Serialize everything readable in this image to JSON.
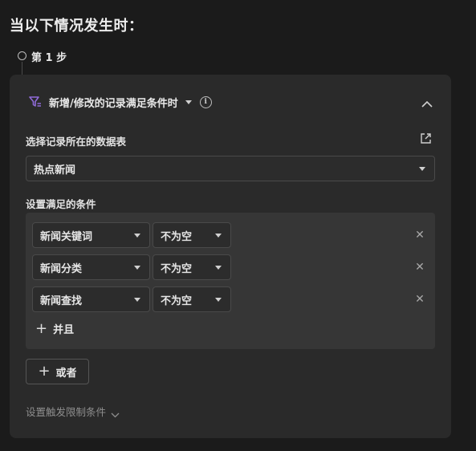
{
  "heading": "当以下情况发生时：",
  "step": {
    "label": "第 1 步"
  },
  "trigger": {
    "label": "新增/修改的记录满足条件时"
  },
  "table_section": {
    "label": "选择记录所在的数据表",
    "selected_table": "热点新闻"
  },
  "conditions_section": {
    "label": "设置满足的条件",
    "rows": [
      {
        "field": "新闻关键词",
        "operator": "不为空"
      },
      {
        "field": "新闻分类",
        "operator": "不为空"
      },
      {
        "field": "新闻查找",
        "operator": "不为空"
      }
    ],
    "and_label": "并且",
    "or_label": "或者"
  },
  "limit": {
    "label": "设置触发限制条件"
  },
  "colors": {
    "background": "#1b1b1b",
    "card": "#2a2a2a",
    "condition_box": "#363636",
    "accent_filter_icon": "#8f6bd8"
  },
  "icons": [
    "filter-icon",
    "chevron-down-icon",
    "info-icon",
    "chevron-up-icon",
    "external-link-icon",
    "close-icon",
    "plus-icon"
  ]
}
